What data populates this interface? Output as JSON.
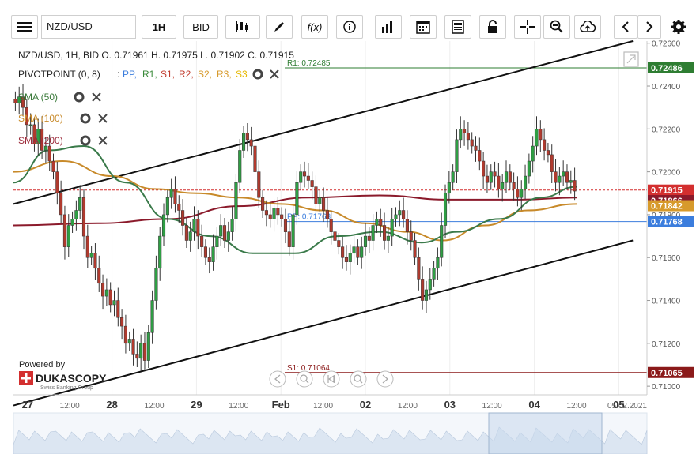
{
  "toolbar": {
    "symbol": "NZD/USD",
    "period": "1H",
    "side": "BID",
    "icons": [
      "menu-icon",
      "candles-icon",
      "draw-icon",
      "function-icon",
      "info-icon",
      "volume-bars-icon",
      "calendar-icon",
      "report-icon",
      "lock-icon",
      "crosshair-icon",
      "zoom-icon",
      "upload-icon",
      "prev-icon",
      "next-icon",
      "settings-icon"
    ],
    "fx_label": "f(x)"
  },
  "header": {
    "ohlc": "NZD/USD, 1H, BID    O. 0.71961  H. 0.71975  L. 0.71902  C. 0.71915",
    "pivot_name": "PIVOTPOINT (0, 8)",
    "pivot_sep": ":",
    "pivot_series": [
      {
        "label": "PP,",
        "color": "#3b7ddd"
      },
      {
        "label": "R1,",
        "color": "#3a8a3a"
      },
      {
        "label": "S1,",
        "color": "#c0392b"
      },
      {
        "label": "R2,",
        "color": "#c0392b"
      },
      {
        "label": "S2,",
        "color": "#d79a2b"
      },
      {
        "label": "R3,",
        "color": "#d79a2b"
      },
      {
        "label": "S3",
        "color": "#e6b800"
      }
    ],
    "sma_50": "SMA (50)",
    "sma_100": "SMA (100)",
    "sma_200": "SMA (200)",
    "powered_by": "Powered by",
    "brand": "DUKASCOPY",
    "brand_sub": "Swiss Banking Group"
  },
  "chart_data": {
    "type": "candlestick",
    "instrument": "NZD/USD",
    "timeframe": "1H",
    "ylim": [
      0.7096,
      0.7261
    ],
    "y_ticks": [
      "0.72600",
      "0.72400",
      "0.72200",
      "0.72000",
      "0.71800",
      "0.71600",
      "0.71400",
      "0.71200",
      "0.71000"
    ],
    "y_tick_values": [
      0.726,
      0.724,
      0.722,
      0.72,
      0.718,
      0.716,
      0.714,
      0.712,
      0.71
    ],
    "x_ticks": [
      "27",
      "12:00",
      "28",
      "12:00",
      "29",
      "12:00",
      "Feb",
      "12:00",
      "02",
      "12:00",
      "03",
      "12:00",
      "04",
      "12:00",
      "05",
      "05.02.2021"
    ],
    "x_tick_hours": [
      0,
      12,
      24,
      36,
      48,
      60,
      72,
      84,
      96,
      108,
      120,
      132,
      144,
      156,
      168,
      176
    ],
    "xlim_hours": [
      -4,
      176
    ],
    "levels": [
      {
        "name": "R1",
        "label": "R1: 0.72485",
        "value": 0.72485,
        "color": "#2e7d32",
        "tag": "0.72486"
      },
      {
        "name": "PP",
        "label": "PP: 0.71768",
        "value": 0.71768,
        "color": "#3b7ddd",
        "tag": "0.71768"
      },
      {
        "name": "S1",
        "label": "S1: 0.71064",
        "value": 0.71064,
        "color": "#8b1a1a",
        "tag": "0.71065"
      },
      {
        "name": "last",
        "value": 0.71915,
        "color": "#d32f2f",
        "tag": "0.71915"
      }
    ],
    "tags": [
      {
        "value": 0.71866,
        "color": "#8b1a2b",
        "text": "0.71866"
      },
      {
        "value": 0.71842,
        "color": "#d79a2b",
        "text": "0.71842"
      }
    ],
    "channel": [
      {
        "from": [
          -4,
          0.7185
        ],
        "to": [
          172,
          0.7261
        ]
      },
      {
        "from": [
          -4,
          0.7091
        ],
        "to": [
          172,
          0.7168
        ]
      }
    ],
    "closes": [
      0.7232,
      0.7235,
      0.723,
      0.7222,
      0.7222,
      0.7213,
      0.722,
      0.721,
      0.7212,
      0.7205,
      0.72,
      0.719,
      0.718,
      0.7165,
      0.7175,
      0.7178,
      0.7182,
      0.7188,
      0.717,
      0.716,
      0.7162,
      0.7155,
      0.7148,
      0.7142,
      0.7145,
      0.7138,
      0.714,
      0.7132,
      0.7128,
      0.712,
      0.7122,
      0.7115,
      0.7113,
      0.712,
      0.7112,
      0.7125,
      0.714,
      0.7155,
      0.717,
      0.718,
      0.7188,
      0.7192,
      0.7185,
      0.7182,
      0.7175,
      0.7168,
      0.7172,
      0.7178,
      0.717,
      0.7165,
      0.716,
      0.7158,
      0.7165,
      0.717,
      0.7175,
      0.7168,
      0.7172,
      0.7178,
      0.7195,
      0.721,
      0.7218,
      0.7215,
      0.7212,
      0.72,
      0.7188,
      0.7182,
      0.718,
      0.7178,
      0.7183,
      0.718,
      0.7178,
      0.7172,
      0.7165,
      0.718,
      0.7195,
      0.72,
      0.7198,
      0.7196,
      0.7193,
      0.7185,
      0.7188,
      0.7182,
      0.7178,
      0.7172,
      0.7168,
      0.7165,
      0.716,
      0.7158,
      0.7162,
      0.7165,
      0.716,
      0.7165,
      0.717,
      0.7168,
      0.7175,
      0.7178,
      0.7175,
      0.7168,
      0.717,
      0.7178,
      0.718,
      0.7182,
      0.7178,
      0.7172,
      0.7168,
      0.716,
      0.715,
      0.714,
      0.7145,
      0.715,
      0.7155,
      0.716,
      0.7175,
      0.719,
      0.7195,
      0.72,
      0.7215,
      0.722,
      0.7218,
      0.7215,
      0.7212,
      0.721,
      0.7205,
      0.7198,
      0.7195,
      0.72,
      0.7198,
      0.7192,
      0.7195,
      0.72,
      0.7195,
      0.7192,
      0.7188,
      0.7192,
      0.7198,
      0.7205,
      0.7212,
      0.722,
      0.7215,
      0.721,
      0.7208,
      0.72,
      0.7195,
      0.7198,
      0.72,
      0.7195,
      0.7196,
      0.7191
    ],
    "sma50": [
      [
        -4,
        0.7195
      ],
      [
        6,
        0.721
      ],
      [
        16,
        0.7212
      ],
      [
        28,
        0.7195
      ],
      [
        40,
        0.7178
      ],
      [
        52,
        0.717
      ],
      [
        64,
        0.7162
      ],
      [
        76,
        0.7162
      ],
      [
        88,
        0.717
      ],
      [
        100,
        0.7172
      ],
      [
        112,
        0.7167
      ],
      [
        122,
        0.7172
      ],
      [
        134,
        0.7178
      ],
      [
        146,
        0.7188
      ],
      [
        156,
        0.7193
      ]
    ],
    "sma100": [
      [
        -4,
        0.72
      ],
      [
        10,
        0.7205
      ],
      [
        24,
        0.7198
      ],
      [
        36,
        0.7192
      ],
      [
        48,
        0.719
      ],
      [
        60,
        0.7188
      ],
      [
        72,
        0.7185
      ],
      [
        84,
        0.7182
      ],
      [
        96,
        0.7176
      ],
      [
        108,
        0.7172
      ],
      [
        118,
        0.7168
      ],
      [
        130,
        0.7175
      ],
      [
        142,
        0.7182
      ],
      [
        156,
        0.7185
      ]
    ],
    "sma200": [
      [
        -4,
        0.7175
      ],
      [
        20,
        0.7176
      ],
      [
        40,
        0.7178
      ],
      [
        60,
        0.7184
      ],
      [
        80,
        0.7188
      ],
      [
        100,
        0.7189
      ],
      [
        120,
        0.7187
      ],
      [
        140,
        0.7187
      ],
      [
        156,
        0.7188
      ]
    ]
  }
}
